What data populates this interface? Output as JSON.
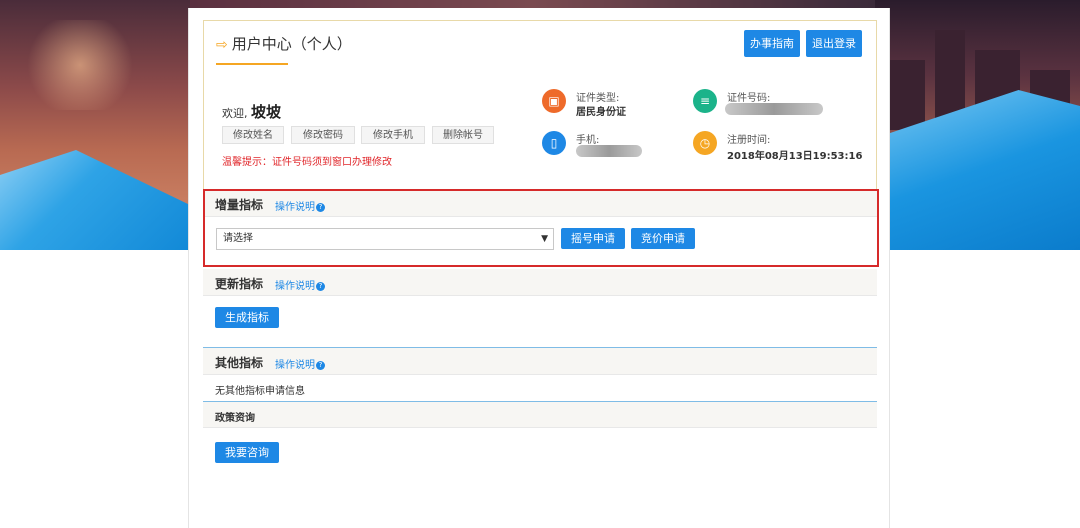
{
  "header": {
    "title": "用户中心（个人）",
    "guide_btn": "办事指南",
    "logout_btn": "退出登录"
  },
  "user": {
    "welcome_prefix": "欢迎,",
    "name": "坡坡",
    "actions": [
      "修改姓名",
      "修改密码",
      "修改手机",
      "删除帐号"
    ],
    "tip": "温馨提示：证件号码须到窗口办理修改",
    "id_type_label": "证件类型:",
    "id_type_value": "居民身份证",
    "id_number_label": "证件号码:",
    "phone_label": "手机:",
    "reg_time_label": "注册时间:",
    "reg_time_value": "2018年08月13日19:53:16"
  },
  "sections": {
    "increment": {
      "title": "增量指标",
      "help": "操作说明",
      "select_value": "请选择",
      "btn_lottery": "摇号申请",
      "btn_bid": "竞价申请"
    },
    "update": {
      "title": "更新指标",
      "help": "操作说明",
      "btn_generate": "生成指标"
    },
    "other": {
      "title": "其他指标",
      "help": "操作说明",
      "empty_text": "无其他指标申请信息"
    },
    "policy": {
      "title": "政策资询",
      "btn_consult": "我要咨询"
    }
  },
  "colors": {
    "accent_blue": "#1e88e5",
    "highlight_red": "#d62a2a",
    "title_accent": "#f5a623"
  }
}
